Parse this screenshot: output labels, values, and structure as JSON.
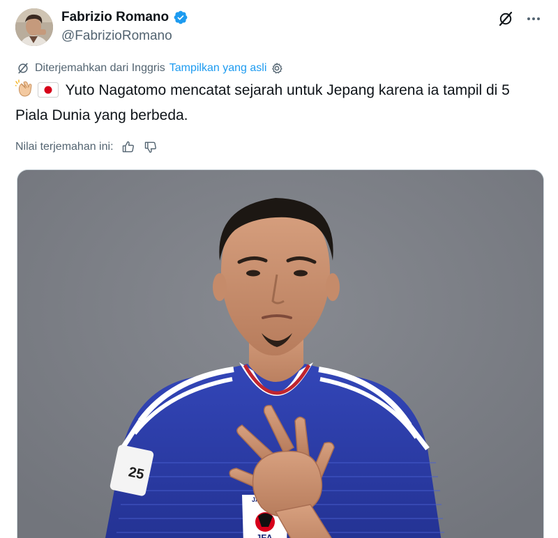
{
  "author": {
    "display_name": "Fabrizio Romano",
    "handle": "@FabrizioRomano",
    "verified": true
  },
  "header_actions": {
    "grok_icon": "grok-slash-icon",
    "more_icon": "more-dots-icon"
  },
  "translation": {
    "label": "Diterjemahkan dari Inggris",
    "show_original": "Tampilkan yang asli",
    "settings_icon": "gear-icon"
  },
  "tweet": {
    "emojis": [
      "clapping-hands-emoji",
      "japan-flag-emoji"
    ],
    "text": "Yuto Nagatomo mencatat sejarah untuk Jepang karena ia tampil di 5 Piala Dunia yang berbeda."
  },
  "rate_translation": {
    "label": "Nilai terjemahan ini:",
    "up_icon": "thumbs-up-icon",
    "down_icon": "thumbs-down-icon"
  },
  "media": {
    "kind": "photo",
    "crest_text": "JAPAN",
    "crest_sub": "JFA",
    "sleeve_badge_number": "25"
  },
  "colors": {
    "text_primary": "#0f1419",
    "text_secondary": "#536471",
    "link": "#1d9bf0",
    "verified": "#1d9bf0",
    "jersey": "#2a3aa6",
    "photo_bg": "#7b7e85"
  }
}
